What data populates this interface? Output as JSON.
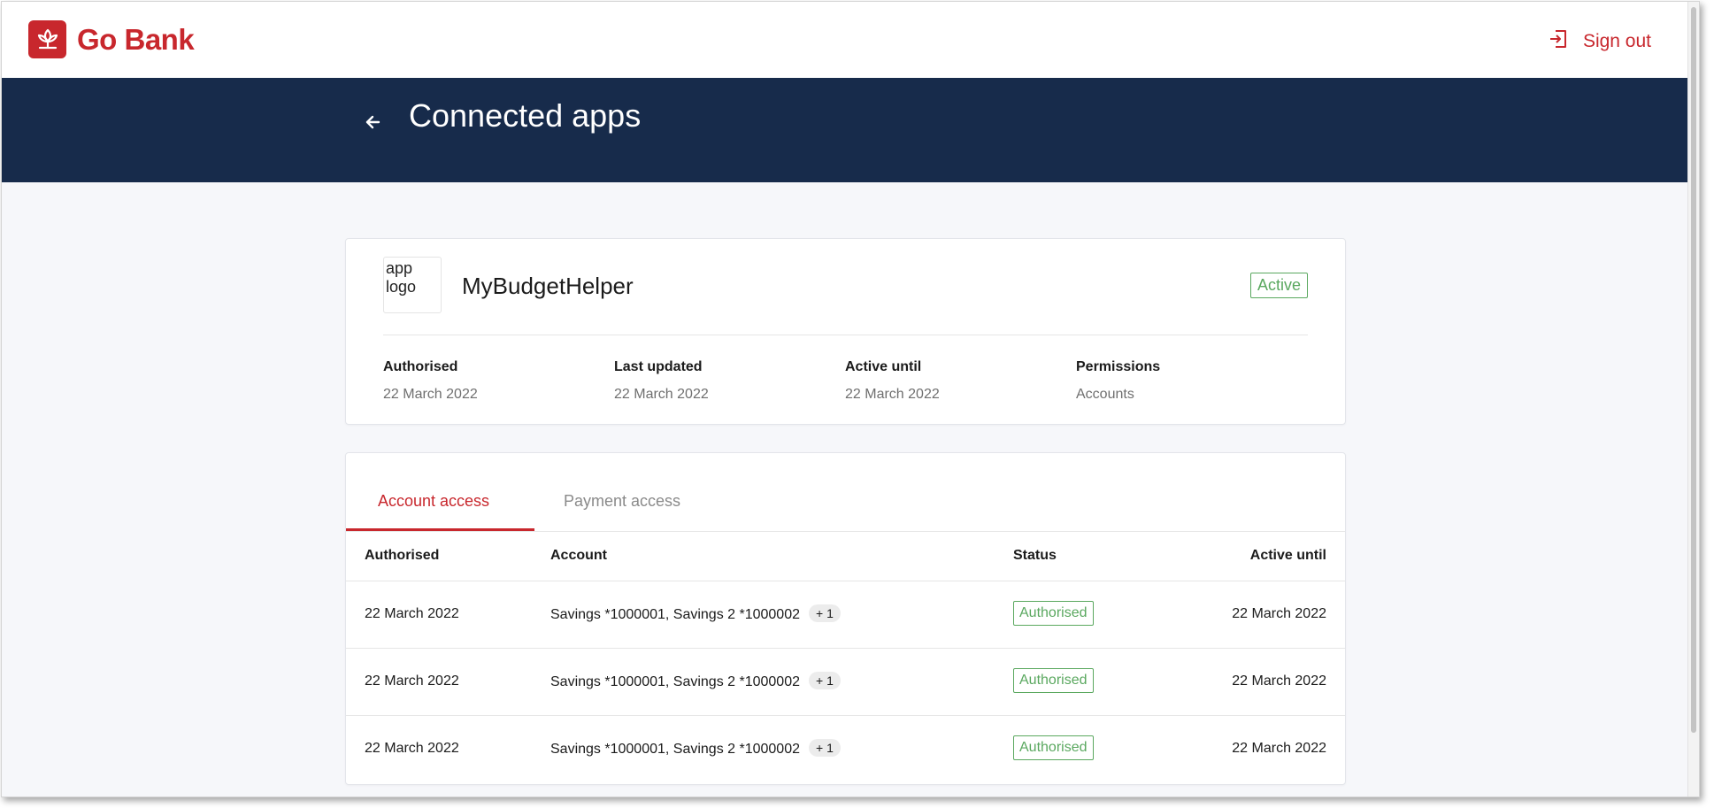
{
  "header": {
    "brand_name": "Go Bank",
    "sign_out_label": "Sign out",
    "brand_color": "#c8272d"
  },
  "hero": {
    "title": "Connected apps",
    "background_color": "#172b4b"
  },
  "app": {
    "logo_alt": "app logo",
    "name": "MyBudgetHelper",
    "status": "Active",
    "details": [
      {
        "label": "Authorised",
        "value": "22 March 2022"
      },
      {
        "label": "Last updated",
        "value": "22 March 2022"
      },
      {
        "label": "Active until",
        "value": "22 March 2022"
      },
      {
        "label": "Permissions",
        "value": "Accounts"
      }
    ]
  },
  "access": {
    "tabs": [
      {
        "label": "Account access",
        "active": true
      },
      {
        "label": "Payment access",
        "active": false
      }
    ],
    "columns": [
      "Authorised",
      "Account",
      "Status",
      "Active until"
    ],
    "rows": [
      {
        "authorised": "22 March 2022",
        "account": "Savings *1000001, Savings 2 *1000002",
        "more": "+ 1",
        "status": "Authorised",
        "active_until": "22 March 2022"
      },
      {
        "authorised": "22 March 2022",
        "account": "Savings *1000001, Savings 2 *1000002",
        "more": "+ 1",
        "status": "Authorised",
        "active_until": "22 March 2022"
      },
      {
        "authorised": "22 March 2022",
        "account": "Savings *1000001, Savings 2 *1000002",
        "more": "+ 1",
        "status": "Authorised",
        "active_until": "22 March 2022"
      }
    ],
    "status_color": "#5aa85f"
  },
  "icons": {
    "brand": "leaf-logo-icon",
    "sign_out": "sign-out-icon",
    "back": "arrow-left-icon"
  }
}
